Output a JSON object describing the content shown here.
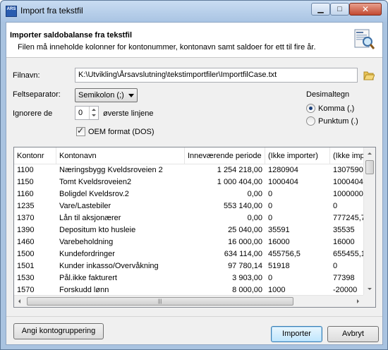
{
  "window": {
    "title": "Import fra tekstfil",
    "app_icon_text": "ARS"
  },
  "header": {
    "title": "Importer saldobalanse fra tekstfil",
    "description": "Filen må inneholde kolonner for kontonummer, kontonavn samt saldoer for ett til fire år."
  },
  "form": {
    "filename_label": "Filnavn:",
    "filename_value": "K:\\Utvikling\\Årsavslutning\\tekstimportfiler\\ImportfilCase.txt",
    "separator_label": "Feltseparator:",
    "separator_value": "Semikolon (;)",
    "ignore_label": "Ignorere de",
    "ignore_value": "0",
    "ignore_suffix": "øverste linjene",
    "oem_label": "OEM format (DOS)",
    "oem_checked": true,
    "decimal_label": "Desimaltegn",
    "decimal_options": [
      "Komma (,)",
      "Punktum (.)"
    ],
    "decimal_selected": "Komma (,)"
  },
  "grid": {
    "columns": [
      "Kontonr",
      "Kontonavn",
      "Inneværende periode",
      "(Ikke importer)",
      "(Ikke impo"
    ],
    "rows": [
      [
        "1100",
        "Næringsbygg Kveldsroveien 2",
        "1 254 218,00",
        "1280904",
        "1307590"
      ],
      [
        "1150",
        "Tomt Kveldsroveien2",
        "1 000 404,00",
        "1000404",
        "1000404"
      ],
      [
        "1160",
        "Boligdel Kveldsrov.2",
        "0,00",
        "0",
        "1000000"
      ],
      [
        "1235",
        "Vare/Lastebiler",
        "553 140,00",
        "0",
        "0"
      ],
      [
        "1370",
        "Lån til aksjonærer",
        "0,00",
        "0",
        "777245,7"
      ],
      [
        "1390",
        "Depositum kto husleie",
        "25 040,00",
        "35591",
        "35535"
      ],
      [
        "1460",
        "Varebeholdning",
        "16 000,00",
        "16000",
        "16000"
      ],
      [
        "1500",
        "Kundefordringer",
        "634 114,00",
        "455756,5",
        "655455,1"
      ],
      [
        "1501",
        "Kunder inkasso/Overvåkning",
        "97 780,14",
        "51918",
        "0"
      ],
      [
        "1530",
        "Pål.ikke fakturert",
        "3 903,00",
        "0",
        "77398"
      ],
      [
        "1570",
        "Forskudd lønn",
        "8 000,00",
        "1000",
        "-20000"
      ]
    ]
  },
  "buttons": {
    "group": "Angi kontogruppering",
    "import": "Importer",
    "cancel": "Avbryt"
  },
  "colors": {
    "title_bar": "#a9c4e3",
    "close_button": "#c24a32",
    "client_bg": "#f0f0f0"
  }
}
